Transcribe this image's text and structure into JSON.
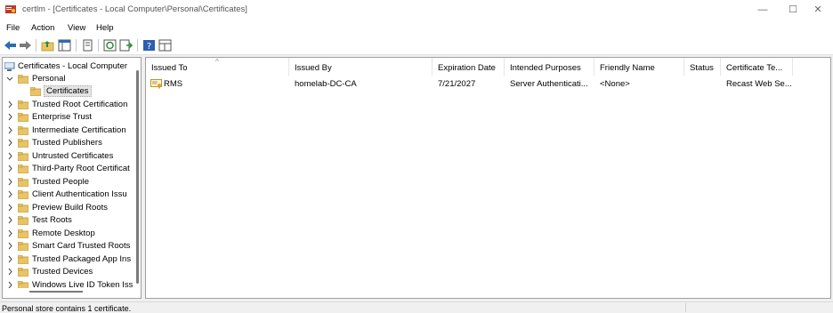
{
  "window": {
    "title": "certlm - [Certificates - Local Computer\\Personal\\Certificates]",
    "minimize_glyph": "—",
    "maximize_glyph": "☐",
    "close_glyph": "✕"
  },
  "menu": [
    "File",
    "Action",
    "View",
    "Help"
  ],
  "toolbar": {
    "buttons": [
      "back-icon",
      "forward-icon",
      "up-folder-icon",
      "show-hide-tree-icon",
      "properties-icon",
      "refresh-icon",
      "export-list-icon",
      "help-icon",
      "view-icon"
    ]
  },
  "tree": {
    "root": "Certificates - Local Computer",
    "personal": "Personal",
    "personal_child": "Certificates",
    "items": [
      "Trusted Root Certification",
      "Enterprise Trust",
      "Intermediate Certification",
      "Trusted Publishers",
      "Untrusted Certificates",
      "Third-Party Root Certificat",
      "Trusted People",
      "Client Authentication Issu",
      "Preview Build Roots",
      "Test Roots",
      "Remote Desktop",
      "Smart Card Trusted Roots",
      "Trusted Packaged App Ins",
      "Trusted Devices",
      "Windows Live ID Token Iss"
    ]
  },
  "list": {
    "columns": [
      "Issued To",
      "Issued By",
      "Expiration Date",
      "Intended Purposes",
      "Friendly Name",
      "Status",
      "Certificate Te..."
    ],
    "sort_glyph": "^",
    "rows": [
      [
        "RMS",
        "homelab-DC-CA",
        "7/21/2027",
        "Server Authenticati...",
        "<None>",
        "",
        "Recast Web Se..."
      ]
    ]
  },
  "status": {
    "text": "Personal store contains 1 certificate."
  },
  "colors": {
    "folder": "#e8c468",
    "folder_dark": "#c9a13e",
    "accent": "#2b6cb0"
  }
}
